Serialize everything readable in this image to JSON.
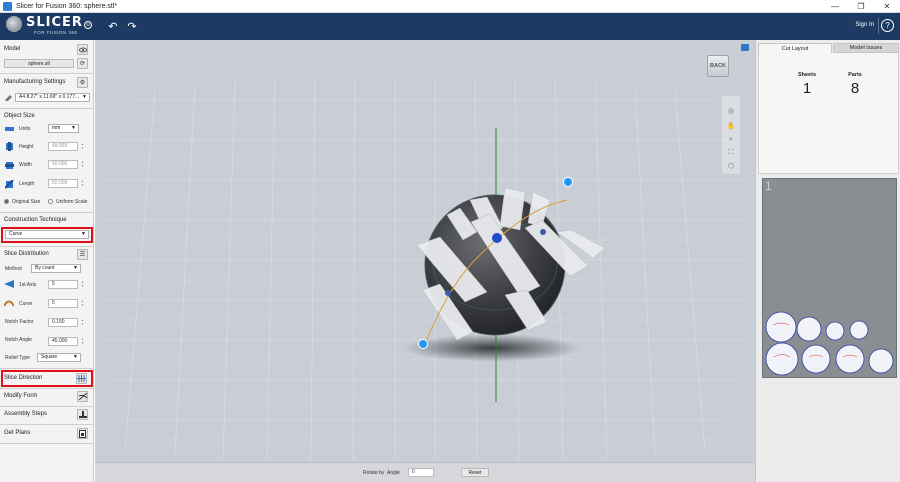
{
  "window": {
    "title": "Slicer for Fusion 360: sphere.stl*",
    "controls": [
      "—",
      "❐",
      "✕"
    ]
  },
  "header": {
    "brand": "SLICER",
    "brand_sub": "FOR FUSION 360",
    "sign_in": "Sign In",
    "help": "?",
    "info": "⊙",
    "undo": "↶",
    "redo": "↷"
  },
  "left": {
    "model": {
      "heading": "Model",
      "file": "sphere.stl"
    },
    "manufacturing": {
      "heading": "Manufacturing Settings",
      "preset": "A4 8.27\" x 11.69\" x 0.177..."
    },
    "object_size": {
      "heading": "Object Size",
      "units_label": "Units",
      "units_value": "mm",
      "height_label": "Height",
      "height_value": "49.993",
      "width_label": "Width",
      "width_value": "50.000",
      "length_label": "Length",
      "length_value": "50.000",
      "original_size": "Original Size",
      "uniform_scale": "Uniform Scale"
    },
    "construction": {
      "heading": "Construction Technique",
      "value": "Curve"
    },
    "slice_distribution": {
      "heading": "Slice Distribution",
      "method_label": "Method",
      "method_value": "By count",
      "axis1_label": "1st Axis",
      "axis1_value": "5",
      "curve_label": "Curve",
      "curve_value": "5",
      "notch_factor_label": "Notch Factor",
      "notch_factor_value": "0.150",
      "notch_angle_label": "Notch Angle",
      "notch_angle_value": "45.000",
      "relief_label": "Relief Type",
      "relief_value": "Square"
    },
    "slice_direction": "Slice Direction",
    "modify_form": "Modify Form",
    "assembly_steps": "Assembly Steps",
    "get_plans": "Get Plans"
  },
  "viewport": {
    "back_label": "BACK",
    "rotate_by": "Rotate by",
    "angle_label": "Angle",
    "angle_value": "0",
    "reset": "Reset"
  },
  "right": {
    "tabs": [
      "Cut Layout",
      "Model Issues"
    ],
    "sheets_label": "Sheets",
    "sheets_value": "1",
    "parts_label": "Parts",
    "parts_value": "8",
    "sheet_number": "1"
  },
  "colors": {
    "header": "#1d3a64",
    "highlight": "#e0101a",
    "accent_blue": "#2196f3",
    "part_outline": "#2a3ea8"
  }
}
